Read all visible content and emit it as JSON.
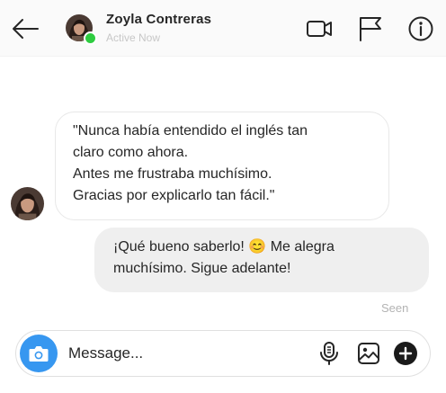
{
  "header": {
    "contact_name": "Zoyla Contreras",
    "status": "Active Now",
    "online_color": "#2ecc40",
    "icons": [
      "back-arrow-icon",
      "video-call-icon",
      "flag-icon",
      "info-icon"
    ]
  },
  "messages": [
    {
      "direction": "incoming",
      "lines": [
        "\"Nunca había entendido el inglés tan",
        "claro como ahora.",
        "Antes me frustraba muchísimo.",
        "Gracias por explicarlo tan fácil.\""
      ]
    },
    {
      "direction": "outgoing",
      "line1_before_emoji": "¡Qué bueno saberlo!",
      "emoji": "😊",
      "line1_after_emoji": "Me alegra",
      "line2": "muchísimo. Sigue adelante!"
    }
  ],
  "seen_label": "Seen",
  "composer": {
    "placeholder": "Message...",
    "value": "",
    "icons": [
      "camera-icon",
      "microphone-icon",
      "gallery-icon",
      "plus-icon"
    ],
    "accent_color": "#3797f0"
  }
}
